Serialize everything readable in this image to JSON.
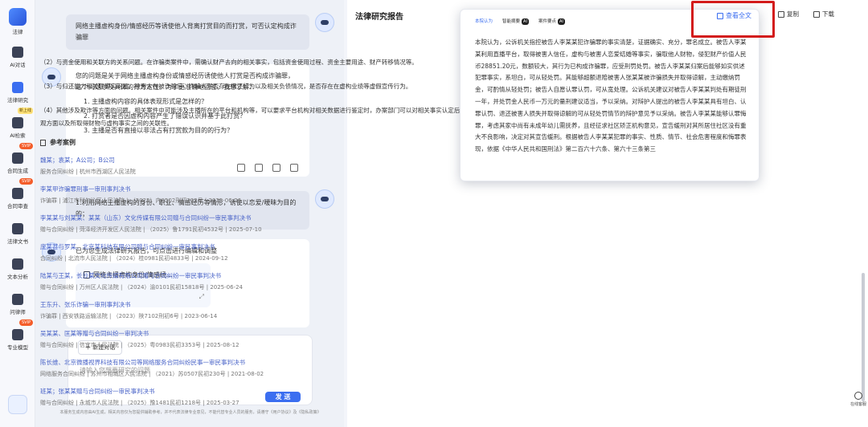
{
  "sidebar": {
    "logo_label": "法律",
    "items": [
      {
        "label": "AI对话",
        "icon": "chat-icon"
      },
      {
        "label": "法律研究",
        "icon": "research-icon",
        "badge": "新上线"
      },
      {
        "label": "AI检索",
        "icon": "search-icon",
        "badge": "SVIP"
      },
      {
        "label": "合同生成",
        "icon": "contract-generate-icon",
        "badge": "SVIP"
      },
      {
        "label": "合同审查",
        "icon": "contract-review-icon"
      },
      {
        "label": "法律文书",
        "icon": "legal-doc-icon"
      },
      {
        "label": "文本分析",
        "icon": "text-analysis-icon"
      },
      {
        "label": "问律师",
        "icon": "lawyer-icon",
        "badge": "SVIP"
      },
      {
        "label": "专业模型",
        "icon": "model-icon"
      }
    ]
  },
  "chat": {
    "user_msg_1": "网络主播虚构身份/情感经历等诱使他人背离打赏目的而打赏，可否认定构成诈骗罪",
    "bot_reply_intro": "您的问题是关于网络主播虚构身份或情感经历诱使他人打赏是否构成诈骗罪，这个问题涉及具体的行为定性。为了更准确地回答，我想了解：",
    "bot_questions": [
      "1. 主播虚构内容的具体表现形式是怎样的？",
      "2. 打赏者是否因虚构内容产生了错误认识并基于此打赏？",
      "3. 主播是否有直接以非法占有打赏款为目的的行为？"
    ],
    "user_msg_2": "1.利用网络主播虚构的身份、职业、情感经历等情形，诱使以恋爱/暧昧为目的的；",
    "bot_reply_2": "已为您生成法律研究报告，可点击进行编辑和调整",
    "doc_card_title": "网络主播虚构身份/情感经...",
    "new_chat_label": "新建对话",
    "input_placeholder": "请输入您想要研究的问题",
    "send_label": "发 送",
    "disclaimer": "本服务生成内容由AI生成，相关内容仅为您提供辅助参考，并不代表法律专业意见，不能代替专业人员的服务，请遵守《用户协议》及《隐私政策》"
  },
  "report": {
    "title": "法律研究报告",
    "copy_label": "复制",
    "download_label": "下载",
    "help_label": "在线客服",
    "paragraphs": [
      "（2）与资金使用和关联方的关系问题。在诈骗类案件中，需确认财产去向的相关事实，包括资金使用过程、资金主要用途、财产转移情况等。",
      "（3）与归还能力和关联事实问题。被害人在被诈骗后，诈骗人是否存在偿还行为以及相关负债情况，是否存在在虚构业绩等虚假宣传行为。",
      "（4）其他涉及欺诈等方面的问题。相关案件中可能涉及主播所在的平台和机构等，可以要求平台机构对相关数据进行鉴定时，办案部门可以对相关事实认定后对行为人主观方面以及所取得财物与虚构事实之间的关联性。"
    ],
    "refs_heading": "参考案例",
    "references": [
      {
        "title": "魏某；袁某；A公司；B公司",
        "meta": "服务合同纠纷 | 杭州市西湖区人民法院"
      },
      {
        "title": "李某甲诈骗罪刑事一审刑事判决书",
        "meta": "诈骗罪 | 浦江市科尔沁区人民法院 | （2025）内0502刑初293号 | 2025-06-26"
      },
      {
        "title": "李某某与刘某某、某某（山东）文化传媒有限公司赠与合同纠纷一审民事判决书",
        "meta": "赠与合同纠纷 | 菏泽经济开发区人民法院 | （2025）鲁1791民初4532号 | 2025-07-10"
      },
      {
        "title": "庞某甚与罗某、北京某科技有限公司赠与合同纠纷一审民事判决书",
        "meta": "合同纠纷 | 北流市人民法院 | （2024）桂0981民初4833号 | 2024-09-12"
      },
      {
        "title": "陆某与王某，长沙某文化传媒有限公司赠与合同纠纷一审民事判决书",
        "meta": "赠与合同纠纷 | 万州区人民法院 | （2024）渝0101民初15818号 | 2025-06-24"
      },
      {
        "title": "王东升、张乐诈骗一审刑事判决书",
        "meta": "诈骗罪 | 西安铁路运输法院 | （2023）陕7102刑初6号 | 2023-06-14"
      },
      {
        "title": "吴某某、匡某等赠与合同纠纷一审判决书",
        "meta": "赠与合同纠纷 | 信宜市人民法院 | （2025）粤0983民初3353号 | 2025-08-12"
      },
      {
        "title": "陈长维、北京微播视界科技有限公司等网络服务合同纠纷民事一审民事判决书",
        "meta": "网络服务合同纠纷 | 苏州市相城区人民法院 | （2021）苏0507民初230号 | 2021-08-02"
      },
      {
        "title": "班某；张某某赠与合同纠纷一审民事判决书",
        "meta": "赠与合同纠纷 | 永城市人民法院 | （2025）豫1481民初1218号 | 2025-03-27"
      }
    ]
  },
  "popup": {
    "tabs": [
      "本院认为",
      "智能摘要",
      "案件要点"
    ],
    "ai_badge": "AI",
    "view_all": "查看全文",
    "text": "本院认为，公诉机关指控被告人李某某犯诈骗罪的事实清楚，证据确实、充分，罪名成立。被告人李某某利用直播平台，取得被害人信任，虚构与被害人恋爱结婚等事实，骗取他人财物，侵犯财产价值人民币28851.20元，数额较大，其行为已构成诈骗罪，应受刑罚处罚。被告人李某某归案后能够如实供述犯罪事实，系坦白，可从轻处罚。其能够超额退赔被害人张某某被诈骗损失并取得谅解，主动缴纳罚金，可酌情从轻处罚；被告人自愿认罪认罚，可从宽处理。公诉机关建议对被告人李某某判处有期徒刑一年，并处罚金人民币一万元的量刑建议适当，予以采纳。对辩护人提出的被告人李某某具有坦白、认罪认罚、退还被害人损失并取得谅解的可从轻处罚情节的辩护意见予以采纳。被告人李某某能够认罪悔罪，考虑其家中尚有未成年幼儿需抚养，且经征求社区矫正机构意见，宣告缓刑对其所居住社区没有重大不良影响，决定对其宣告缓刑。根据被告人李某某犯罪的事实、性质、情节、社会危害程度和悔罪表现，依据《中华人民共和国刑法》第二百六十六条、第六十三条第三"
  }
}
